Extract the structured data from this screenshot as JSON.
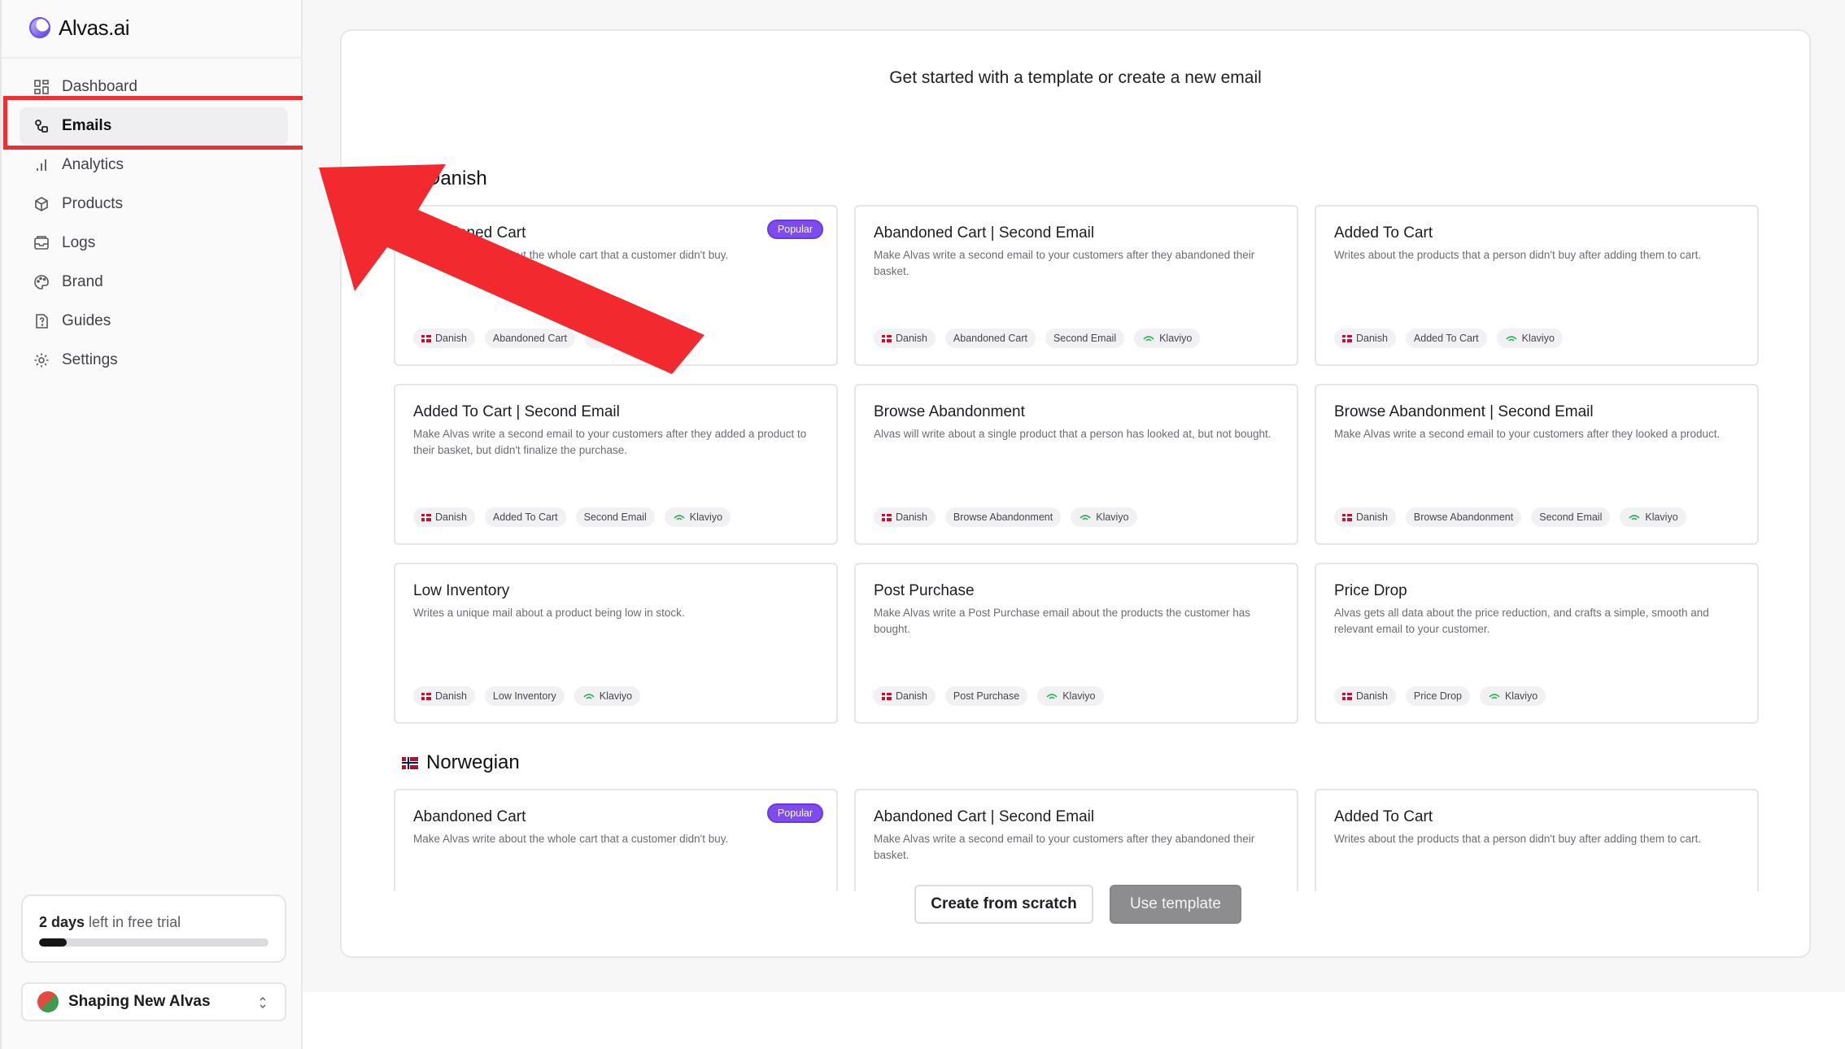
{
  "app": {
    "name": "Alvas.ai"
  },
  "sidebar": {
    "items": [
      {
        "label": "Dashboard",
        "icon": "dashboard-icon"
      },
      {
        "label": "Emails",
        "icon": "emails-icon",
        "active": true
      },
      {
        "label": "Analytics",
        "icon": "analytics-icon"
      },
      {
        "label": "Products",
        "icon": "products-icon"
      },
      {
        "label": "Logs",
        "icon": "logs-icon"
      },
      {
        "label": "Brand",
        "icon": "palette-icon"
      },
      {
        "label": "Guides",
        "icon": "guides-icon"
      },
      {
        "label": "Settings",
        "icon": "gear-icon"
      }
    ],
    "trial": {
      "days": "2 days",
      "suffix": " left in free trial",
      "progress": 0.12
    },
    "workspace": {
      "name": "Shaping New Alvas"
    }
  },
  "main": {
    "title": "Get started with a template or create a new email",
    "sections": [
      {
        "name": "Danish",
        "cards": [
          {
            "title": "Abandoned Cart",
            "desc": "Make Alvas write about the whole cart that a customer didn't buy.",
            "badge": "Popular",
            "tags": [
              "Danish",
              "Abandoned Cart",
              "Klaviyo"
            ]
          },
          {
            "title": "Abandoned Cart | Second Email",
            "desc": "Make Alvas write a second email to your customers after they abandoned their basket.",
            "tags": [
              "Danish",
              "Abandoned Cart",
              "Second Email",
              "Klaviyo"
            ]
          },
          {
            "title": "Added To Cart",
            "desc": "Writes about the products that a person didn't buy after adding them to cart.",
            "tags": [
              "Danish",
              "Added To Cart",
              "Klaviyo"
            ]
          },
          {
            "title": "Added To Cart | Second Email",
            "desc": "Make Alvas write a second email to your customers after they added a product to their basket, but didn't finalize the purchase.",
            "tags": [
              "Danish",
              "Added To Cart",
              "Second Email",
              "Klaviyo"
            ]
          },
          {
            "title": "Browse Abandonment",
            "desc": "Alvas will write about a single product that a person has looked at, but not bought.",
            "tags": [
              "Danish",
              "Browse Abandonment",
              "Klaviyo"
            ]
          },
          {
            "title": "Browse Abandonment | Second Email",
            "desc": "Make Alvas write a second email to your customers after they looked a product.",
            "tags": [
              "Danish",
              "Browse Abandonment",
              "Second Email",
              "Klaviyo"
            ]
          },
          {
            "title": "Low Inventory",
            "desc": "Writes a unique mail about a product being low in stock.",
            "tags": [
              "Danish",
              "Low Inventory",
              "Klaviyo"
            ]
          },
          {
            "title": "Post Purchase",
            "desc": "Make Alvas write a Post Purchase email about the products the customer has bought.",
            "tags": [
              "Danish",
              "Post Purchase",
              "Klaviyo"
            ]
          },
          {
            "title": "Price Drop",
            "desc": "Alvas gets all data about the price reduction, and crafts a simple, smooth and relevant email to your customer.",
            "tags": [
              "Danish",
              "Price Drop",
              "Klaviyo"
            ]
          }
        ]
      },
      {
        "name": "Norwegian",
        "cards": [
          {
            "title": "Abandoned Cart",
            "desc": "Make Alvas write about the whole cart that a customer didn't buy.",
            "badge": "Popular",
            "tags": []
          },
          {
            "title": "Abandoned Cart | Second Email",
            "desc": "Make Alvas write a second email to your customers after they abandoned their basket.",
            "tags": []
          },
          {
            "title": "Added To Cart",
            "desc": "Writes about the products that a person didn't buy after adding them to cart.",
            "tags": []
          }
        ]
      }
    ],
    "buttons": {
      "scratch": "Create from scratch",
      "template": "Use template"
    }
  },
  "colors": {
    "accent": "#7c4dec",
    "annotation": "#ef2f2f",
    "klaviyo": "#2eb35a"
  }
}
